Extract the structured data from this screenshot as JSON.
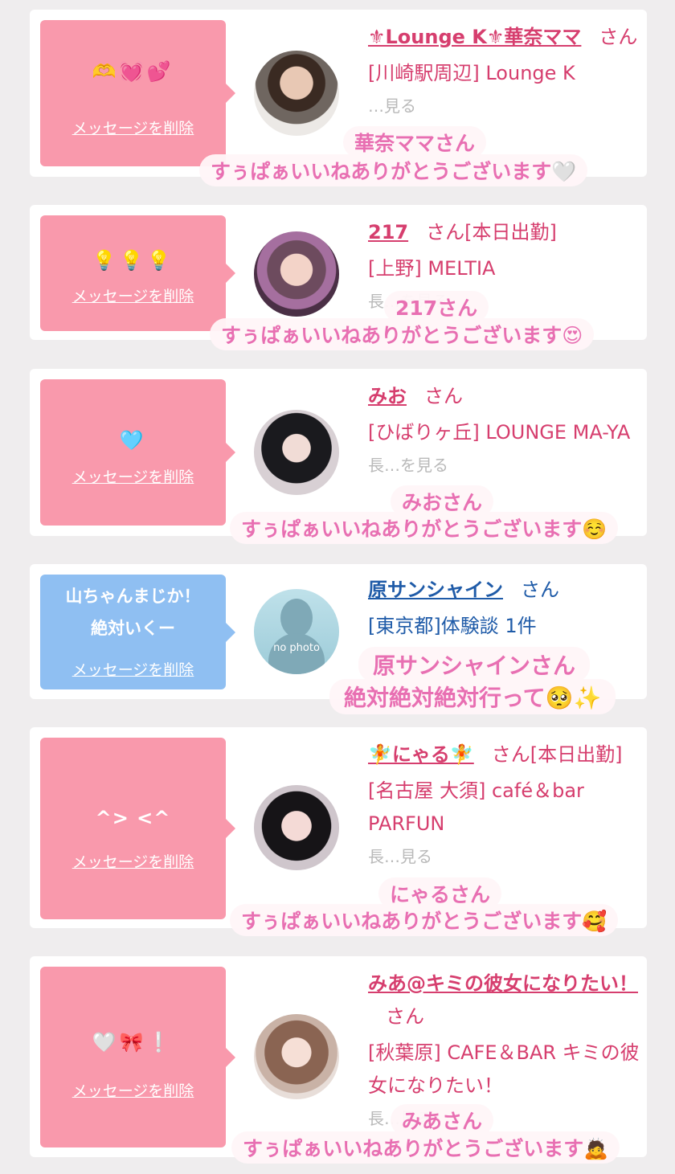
{
  "delete_label": "メッセージを削除",
  "cards": [
    {
      "message": "🫶💓💕",
      "name": "⚜Lounge K⚜華奈ママ",
      "san": "さん",
      "extra": "",
      "location": "[川崎駅周辺] Lounge K",
      "faded": "…見る",
      "sticker_name": "華奈ママさん",
      "sticker_msg": "すぅぱぁいいねありがとうございます🤍"
    },
    {
      "message": "💡💡💡",
      "name": "217",
      "san": "さん",
      "extra": "[本日出勤]",
      "location": "[上野] MELTIA",
      "faded": "長…を見る",
      "sticker_name": "217さん",
      "sticker_msg": "すぅぱぁいいねありがとうございます😍"
    },
    {
      "message": "🩵",
      "name": "みお",
      "san": "さん",
      "extra": "",
      "location": "[ひばりヶ丘] LOUNGE MA-YA",
      "faded": "長…を見る",
      "sticker_name": "みおさん",
      "sticker_msg": "すぅぱぁいいねありがとうございます☺️"
    },
    {
      "message": "山ちゃんまじか！絶対いくー",
      "name": "原サンシャイン",
      "san": "さん",
      "extra": "",
      "location": "[東京都]体験談 1件",
      "faded": "",
      "avatar_text": "no photo",
      "sticker_name": "原サンシャインさん",
      "sticker_msg": "絶対絶対絶対行って🥺✨"
    },
    {
      "message": "^> <^",
      "name": "🧚にゃる🧚",
      "san": "さん",
      "extra": "[本日出勤]",
      "location": "[名古屋 大須] café＆bar PARFUN",
      "faded": "長…見る",
      "sticker_name": "にゃるさん",
      "sticker_msg": "すぅぱぁいいねありがとうございます🥰"
    },
    {
      "message": "🤍🎀❕",
      "name": "みあ@キミの彼女になりたい！",
      "san": "さん",
      "extra": "",
      "location": "[秋葉原] CAFE＆BAR キミの彼女になりたい！",
      "faded": "長…見る",
      "sticker_name": "みあさん",
      "sticker_msg": "すぅぱぁいいねありがとうございます🙇"
    }
  ],
  "colors": {
    "pink_bubble": "#f999ac",
    "blue_bubble": "#8fbff2",
    "name_pink": "#d63e6e",
    "name_blue": "#1f5ba8",
    "sticker_text": "#e86fb2"
  }
}
